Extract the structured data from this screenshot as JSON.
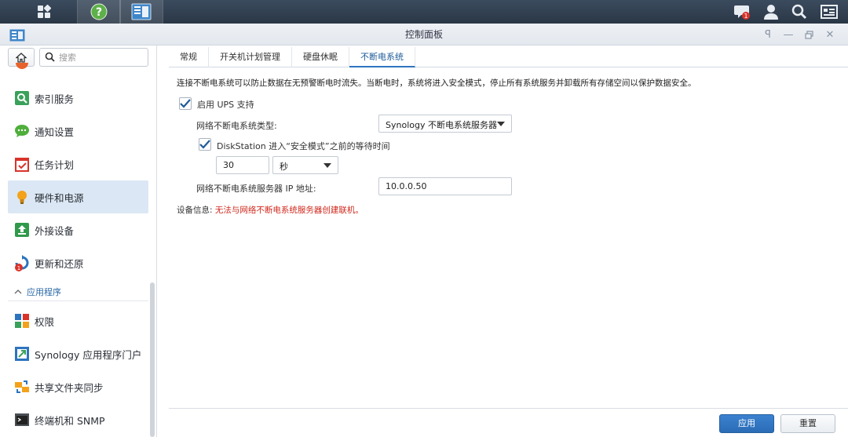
{
  "window": {
    "title": "控制面板"
  },
  "taskbar": {
    "notification_count": "1"
  },
  "sidebar": {
    "search_placeholder": "搜索",
    "items": [
      {
        "label": "索引服务"
      },
      {
        "label": "通知设置"
      },
      {
        "label": "任务计划"
      },
      {
        "label": "硬件和电源"
      },
      {
        "label": "外接设备"
      },
      {
        "label": "更新和还原",
        "badge": "1"
      }
    ],
    "section_label": "应用程序",
    "app_items": [
      {
        "label": "权限"
      },
      {
        "label": "Synology 应用程序门户"
      },
      {
        "label": "共享文件夹同步"
      },
      {
        "label": "终端机和 SNMP"
      }
    ]
  },
  "tabs": [
    {
      "label": "常规"
    },
    {
      "label": "开关机计划管理"
    },
    {
      "label": "硬盘休眠"
    },
    {
      "label": "不断电系统"
    }
  ],
  "ups": {
    "description": "连接不断电系统可以防止数据在无预警断电时流失。当断电时，系统将进入安全模式，停止所有系统服务并卸载所有存储空间以保护数据安全。",
    "enable_label": "启用 UPS 支持",
    "type_label": "网络不断电系统类型:",
    "type_value": "Synology 不断电系统服务器",
    "wait_label": "DiskStation 进入“安全模式”之前的等待时间",
    "wait_value": "30",
    "wait_unit": "秒",
    "ip_label": "网络不断电系统服务器 IP 地址:",
    "ip_value": "10.0.0.50",
    "status_key": "设备信息:",
    "status_value": "无法与网络不断电系统服务器创建联机。"
  },
  "footer": {
    "apply_label": "应用",
    "reset_label": "重置"
  },
  "colors": {
    "accent": "#2d74be",
    "error": "#d0281c",
    "selected_bg": "#dbe7f4"
  }
}
